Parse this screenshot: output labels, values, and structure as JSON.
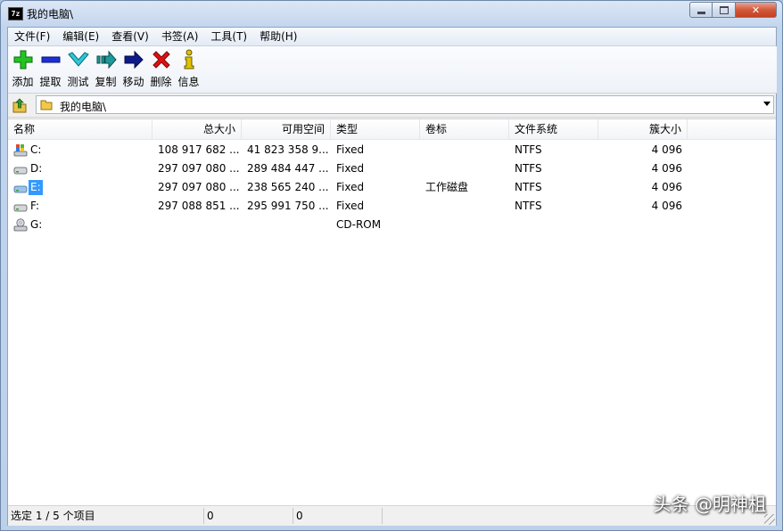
{
  "window": {
    "title": "我的电脑\\",
    "app_icon_text": "7z"
  },
  "menu": [
    {
      "label": "文件(F)"
    },
    {
      "label": "编辑(E)"
    },
    {
      "label": "查看(V)"
    },
    {
      "label": "书签(A)"
    },
    {
      "label": "工具(T)"
    },
    {
      "label": "帮助(H)"
    }
  ],
  "toolbar": [
    {
      "label": "添加",
      "icon": "plus-icon",
      "color": "#1fbf1f"
    },
    {
      "label": "提取",
      "icon": "minus-icon",
      "color": "#1c2fd6"
    },
    {
      "label": "测试",
      "icon": "check-chevron-icon",
      "color": "#1fb4c6"
    },
    {
      "label": "复制",
      "icon": "copy-arrow-icon",
      "color": "#1f8f8f"
    },
    {
      "label": "移动",
      "icon": "move-arrow-icon",
      "color": "#0c1a8a"
    },
    {
      "label": "删除",
      "icon": "x-icon",
      "color": "#e01010"
    },
    {
      "label": "信息",
      "icon": "info-icon",
      "color": "#d6b800"
    }
  ],
  "address": {
    "path": "我的电脑\\"
  },
  "columns": [
    {
      "label": "名称"
    },
    {
      "label": "总大小"
    },
    {
      "label": "可用空间"
    },
    {
      "label": "类型"
    },
    {
      "label": "卷标"
    },
    {
      "label": "文件系统"
    },
    {
      "label": "簇大小"
    }
  ],
  "rows": [
    {
      "name": "C:",
      "icon": "system-drive-icon",
      "total": "108 917 682 ...",
      "free": "41 823 358 9...",
      "type": "Fixed",
      "label": "",
      "fs": "NTFS",
      "cluster": "4 096",
      "selected": false
    },
    {
      "name": "D:",
      "icon": "hard-drive-icon",
      "total": "297 097 080 ...",
      "free": "289 484 447 ...",
      "type": "Fixed",
      "label": "",
      "fs": "NTFS",
      "cluster": "4 096",
      "selected": false
    },
    {
      "name": "E:",
      "icon": "hard-drive-icon",
      "total": "297 097 080 ...",
      "free": "238 565 240 ...",
      "type": "Fixed",
      "label": "工作磁盘",
      "fs": "NTFS",
      "cluster": "4 096",
      "selected": true
    },
    {
      "name": "F:",
      "icon": "hard-drive-icon",
      "total": "297 088 851 ...",
      "free": "295 991 750 ...",
      "type": "Fixed",
      "label": "",
      "fs": "NTFS",
      "cluster": "4 096",
      "selected": false
    },
    {
      "name": "G:",
      "icon": "cd-drive-icon",
      "total": "",
      "free": "",
      "type": "CD-ROM",
      "label": "",
      "fs": "",
      "cluster": "",
      "selected": false
    }
  ],
  "status": {
    "selection": "选定 1 / 5 个项目",
    "size": "0",
    "packed": "0"
  },
  "watermark": "头条 @明神柤"
}
